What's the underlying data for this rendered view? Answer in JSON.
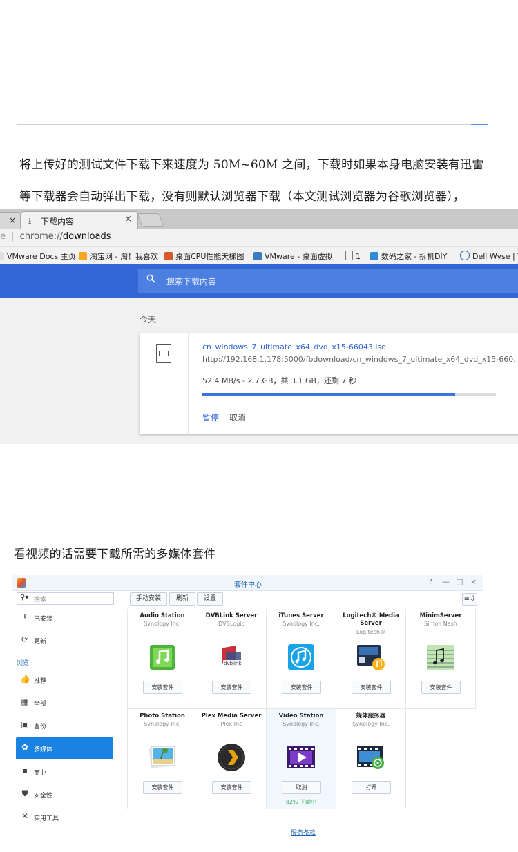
{
  "article": {
    "para1_line1": "将上传好的测试文件下载下来速度为 50M~60M 之间，下载时如果本身电脑安装有迅雷",
    "para1_line2": "等下载器会自动弹出下载，没有则默认浏览器下载（本文测试浏览器为谷歌浏览器），",
    "para2": "看视频的话需要下载所需的多媒体套件"
  },
  "chrome": {
    "prev_tab_close": "×",
    "tab_title": "下载内容",
    "tab_close": "×",
    "address_scheme": "chrome://",
    "address_path": "downloads",
    "bookmarks": [
      {
        "label": "VMware Docs 主页",
        "color": "#ffffff"
      },
      {
        "label": "淘宝网 - 淘！我喜欢",
        "color": "#f5a623"
      },
      {
        "label": "桌面CPU性能天梯图",
        "color": "#d9572b"
      },
      {
        "label": "VMware - 桌面虚拟",
        "color": "#3b7bbf"
      },
      {
        "label": "1",
        "color": "#ffffff"
      },
      {
        "label": "数码之家 - 拆机DIY",
        "color": "#2e8bd8"
      },
      {
        "label": "Dell Wyse | T",
        "color": "#1a6fc0"
      }
    ],
    "search_placeholder": "搜索下载内容",
    "today_label": "今天",
    "download": {
      "filename": "cn_windows_7_ultimate_x64_dvd_x15-66043.iso",
      "url": "http://192.168.1.178:5000/fbdownload/cn_windows_7_ultimate_x64_dvd_x15-660...",
      "status": "52.4 MB/s - 2.7 GB，共 3.1 GB，还剩 7 秒",
      "progress": 0.862,
      "pause_label": "暂停",
      "cancel_label": "取消"
    }
  },
  "package_center": {
    "title": "套件中心",
    "window_buttons": [
      "?",
      "—",
      "□",
      "×"
    ],
    "search_placeholder": "搜索",
    "nav": [
      {
        "label": "已安装",
        "icon": "download-icon"
      },
      {
        "label": "更新",
        "icon": "refresh-icon"
      }
    ],
    "section_label": "浏览",
    "browse": [
      {
        "label": "推荐",
        "icon": "thumbs-up-icon"
      },
      {
        "label": "全部",
        "icon": "grid-icon"
      },
      {
        "label": "备份",
        "icon": "backup-icon"
      },
      {
        "label": "多媒体",
        "icon": "film-reel-icon"
      },
      {
        "label": "商业",
        "icon": "briefcase-icon"
      },
      {
        "label": "安全性",
        "icon": "shield-icon"
      },
      {
        "label": "实用工具",
        "icon": "tools-icon"
      }
    ],
    "active_category": "多媒体",
    "toolbar": {
      "manual_install": "手动安装",
      "refresh": "刷新",
      "settings": "设置",
      "sort": "≡⇩"
    },
    "packages": [
      {
        "name": "Audio Station",
        "vendor": "Synology Inc.",
        "button": "安装套件",
        "icon": "audio-station-icon"
      },
      {
        "name": "DVBLink Server",
        "vendor": "DVBLogic",
        "button": "安装套件",
        "icon": "dvblink-icon"
      },
      {
        "name": "iTunes Server",
        "vendor": "Synology Inc.",
        "button": "安装套件",
        "icon": "itunes-icon"
      },
      {
        "name": "Logitech® Media Server",
        "vendor": "Logitech®",
        "button": "安装套件",
        "icon": "logitech-media-icon"
      },
      {
        "name": "MinimServer",
        "vendor": "Simon Nash",
        "button": "安装套件",
        "icon": "minimserver-icon"
      },
      {
        "name": "Photo Station",
        "vendor": "Synology Inc.",
        "button": "安装套件",
        "icon": "photo-station-icon"
      },
      {
        "name": "Plex Media Server",
        "vendor": "Plex Inc",
        "button": "安装套件",
        "icon": "plex-icon"
      },
      {
        "name": "Video Station",
        "vendor": "Synology Inc.",
        "button": "取消",
        "icon": "video-station-icon",
        "progress_text": "82% 下载中"
      },
      {
        "name": "媒体服务器",
        "vendor": "Synology Inc.",
        "button": "打开",
        "icon": "media-server-icon"
      }
    ],
    "terms_link": "服务条款"
  }
}
